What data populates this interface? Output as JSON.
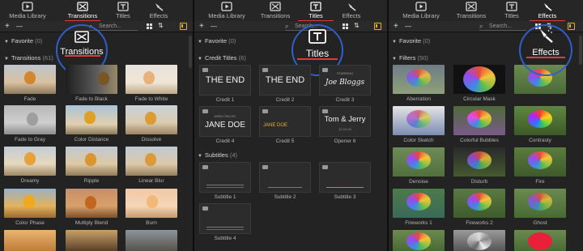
{
  "tabs": {
    "media_library": "Media Library",
    "transitions": "Transitions",
    "titles": "Titles",
    "effects": "Effects"
  },
  "toolbar": {
    "add": "+",
    "remove": "—",
    "search_placeholder": "Search..."
  },
  "panel_transitions": {
    "highlight_label": "Transitions",
    "favorite_label": "Favorite",
    "favorite_count": "(0)",
    "section_label": "Transitions",
    "section_count": "(61)",
    "items": [
      "Fade",
      "Fade to Black",
      "Fade to White",
      "Fade to Gray",
      "Color Distance",
      "Dissolve",
      "Dreamy",
      "Ripple",
      "Linear Blur",
      "Color Phase",
      "Multiply Blend",
      "Burn"
    ]
  },
  "panel_titles": {
    "highlight_label": "Titles",
    "favorite_label": "Favorite",
    "favorite_count": "(0)",
    "credit_label": "Credit Titles",
    "credit_count": "(6)",
    "credit_items": [
      {
        "caption": "Credit 1",
        "text": "THE END"
      },
      {
        "caption": "Credit 2",
        "text": "THE END"
      },
      {
        "caption": "Credit 3",
        "small": "STARRING",
        "text": "Joe Bloggs"
      },
      {
        "caption": "Credit 4",
        "small": "DIRECTED BY",
        "text": "JANE DOE"
      },
      {
        "caption": "Credit 5",
        "text": "JANE DOE"
      },
      {
        "caption": "Opener 6",
        "text": "Tom & Jerry",
        "small": "12.12.16"
      }
    ],
    "subtitles_label": "Subtitles",
    "subtitles_count": "(4)",
    "subtitle_items": [
      "Subtitle 1",
      "Subtitle 2",
      "Subtitle 3",
      "Subtitle 4"
    ]
  },
  "panel_effects": {
    "highlight_label": "Effects",
    "favorite_label": "Favorite",
    "favorite_count": "(0)",
    "filters_label": "Filters",
    "filters_count": "(50)",
    "items": [
      "Aberration",
      "Circular Mask",
      "Color Sketch",
      "Colorful Bubbles",
      "Contrasty",
      "Denoise",
      "Disturb",
      "Fire",
      "Fireworks 1",
      "Fireworks 2",
      "Ghost"
    ]
  },
  "colors": {
    "accent_underline": "#e03b3b",
    "highlight_ring": "#2f5fc9",
    "toggle_yellow": "#e0b020"
  }
}
